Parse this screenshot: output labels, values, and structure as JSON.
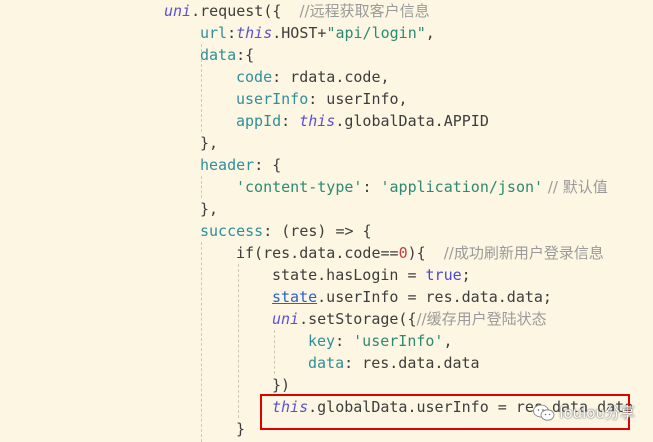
{
  "colors": {
    "background": "#fdf6e3",
    "keyword": "#5a50d8",
    "property": "#2f8f9a",
    "string": "#2c8a74",
    "number": "#c23d3d",
    "comment": "#9a9a9a",
    "highlight_box": "#e00000"
  },
  "code": {
    "l1": {
      "ns": "uni",
      "text": ".request({  ",
      "comment": "//远程获取客户信息"
    },
    "l2": {
      "prop": "url",
      "colon": ":",
      "kw": "this",
      "text": ".HOST+",
      "str": "\"api/login\"",
      "end": ","
    },
    "l3": {
      "prop": "data",
      "text": ":{"
    },
    "l4": {
      "prop": "code",
      "text": ": rdata.code,"
    },
    "l5": {
      "prop": "userInfo",
      "text": ": userInfo,"
    },
    "l6": {
      "prop": "appId",
      "colon": ": ",
      "kw": "this",
      "text": ".globalData.APPID"
    },
    "l7": {
      "text": "},"
    },
    "l8": {
      "prop": "header",
      "text": ": {"
    },
    "l9": {
      "str1": "'content-type'",
      "mid": ": ",
      "str2": "'application/json'",
      "comment": " // 默认值"
    },
    "l10": {
      "text": "},"
    },
    "l11": {
      "prop": "success",
      "text": ": (res) => {"
    },
    "l12": {
      "a": "if(res.data.code==",
      "num": "0",
      "b": "){  ",
      "comment": "//成功刷新用户登录信息"
    },
    "l13": {
      "text": "state.hasLogin = ",
      "bool": "true",
      "end": ";"
    },
    "l14": {
      "ul": "state",
      "text": ".userInfo = res.data.data;"
    },
    "l15": {
      "ns": "uni",
      "text": ".setStorage({",
      "comment": "//缓存用户登陆状态"
    },
    "l16": {
      "prop": "key",
      "colon": ": ",
      "str": "'userInfo'",
      "end": ","
    },
    "l17": {
      "prop": "data",
      "text": ": res.data.data"
    },
    "l18": {
      "text": "})"
    },
    "l19": {
      "kw": "this",
      "text": ".globalData.userInfo = res.data.data"
    },
    "l20": {
      "text": "}"
    }
  },
  "watermark": {
    "icon": "wechat-icon",
    "label": "loulou分享"
  }
}
